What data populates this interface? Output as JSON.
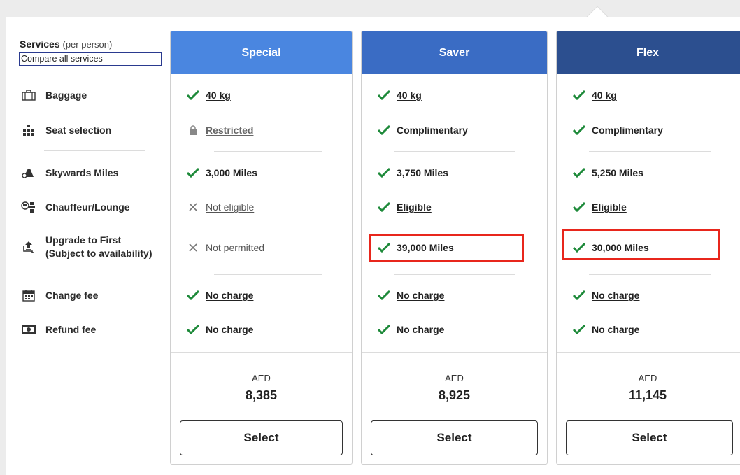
{
  "services": {
    "title": "Services",
    "subtitle": "(per person)",
    "compare_link": "Compare all services",
    "items": [
      {
        "label": "Baggage",
        "icon": "suitcase-icon"
      },
      {
        "label": "Seat selection",
        "icon": "seat-icon"
      },
      {
        "label": "Skywards Miles",
        "icon": "airplane-takeoff-icon"
      },
      {
        "label": "Chauffeur/Lounge",
        "icon": "chauffeur-icon"
      },
      {
        "label_line1": "Upgrade to First",
        "label_line2": "(Subject to availability)",
        "icon": "upgrade-seat-icon"
      },
      {
        "label": "Change fee",
        "icon": "calendar-icon"
      },
      {
        "label": "Refund fee",
        "icon": "banknote-icon"
      }
    ]
  },
  "fares": [
    {
      "name": "Special",
      "header_color": "#4a86e0",
      "baggage": "40 kg",
      "seat": "Restricted",
      "miles": "3,000 Miles",
      "chauffeur": "Not eligible",
      "upgrade": "Not permitted",
      "change": "No charge",
      "refund": "No charge",
      "currency": "AED",
      "price": "8,385",
      "select": "Select"
    },
    {
      "name": "Saver",
      "header_color": "#3a6cc4",
      "baggage": "40 kg",
      "seat": "Complimentary",
      "miles": "3,750 Miles",
      "chauffeur": "Eligible",
      "upgrade": "39,000 Miles",
      "change": "No charge",
      "refund": "No charge",
      "currency": "AED",
      "price": "8,925",
      "select": "Select"
    },
    {
      "name": "Flex",
      "header_color": "#2c4f8f",
      "baggage": "40 kg",
      "seat": "Complimentary",
      "miles": "5,250 Miles",
      "chauffeur": "Eligible",
      "upgrade": "30,000 Miles",
      "change": "No charge",
      "refund": "No charge",
      "currency": "AED",
      "price": "11,145",
      "select": "Select"
    }
  ],
  "colors": {
    "check": "#1e8a3a",
    "highlight": "#e8261c",
    "special": "#4a86e0",
    "saver": "#3a6cc4",
    "flex": "#2c4f8f"
  }
}
